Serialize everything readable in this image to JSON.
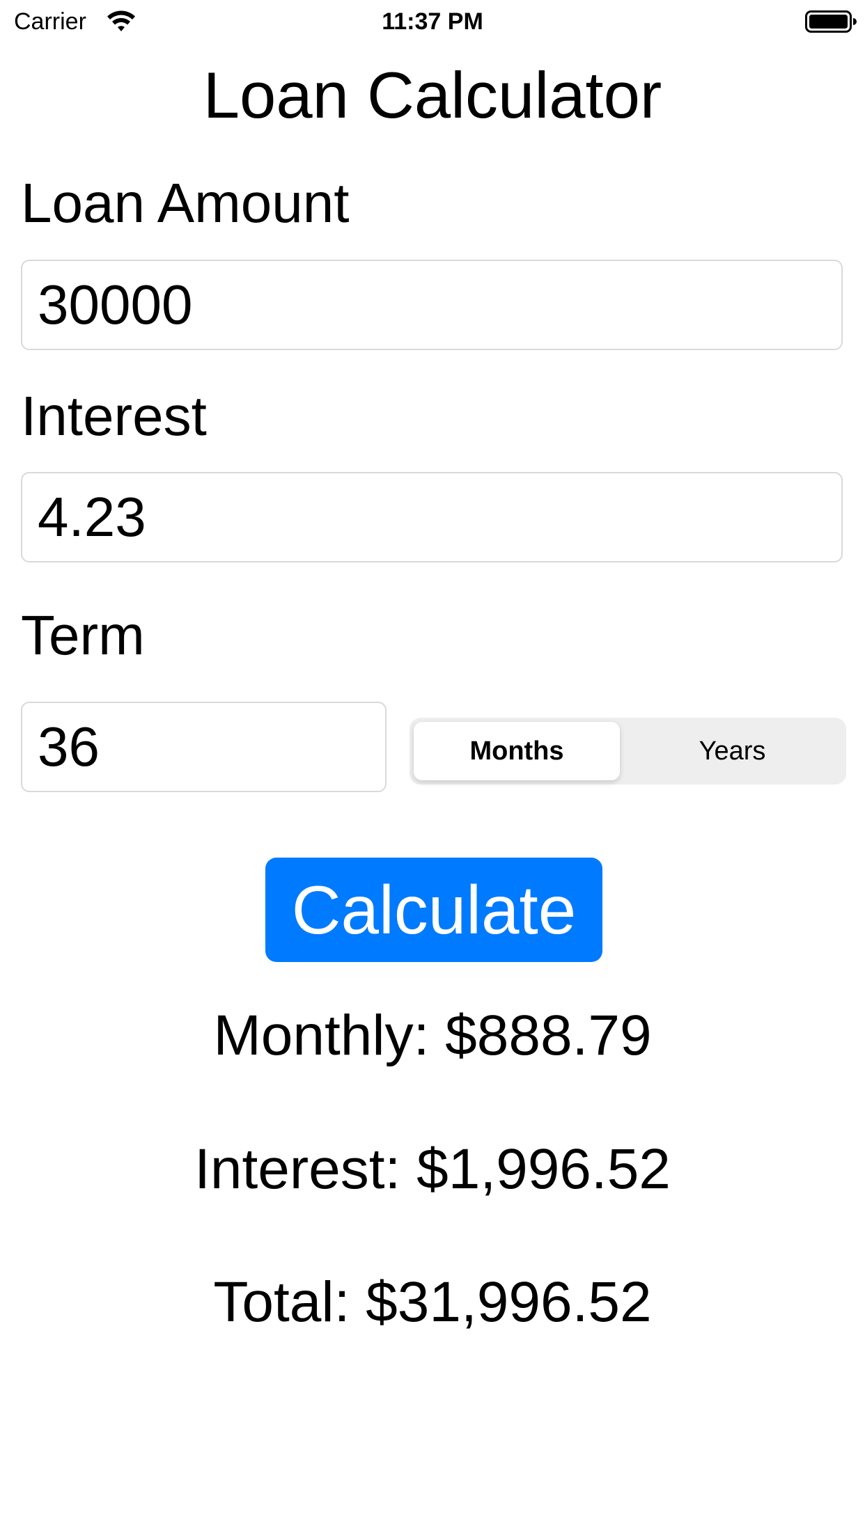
{
  "status_bar": {
    "carrier": "Carrier",
    "time": "11:37 PM",
    "wifi_icon": "wifi-icon",
    "battery_icon": "battery-icon"
  },
  "title": "Loan Calculator",
  "loan_amount": {
    "label": "Loan Amount",
    "value": "30000"
  },
  "interest": {
    "label": "Interest",
    "value": "4.23"
  },
  "term": {
    "label": "Term",
    "value": "36",
    "units": {
      "options": [
        "Months",
        "Years"
      ],
      "selected": "Months"
    }
  },
  "calculate_label": "Calculate",
  "results": {
    "monthly": "Monthly: $888.79",
    "interest": "Interest: $1,996.52",
    "total": "Total: $31,996.52"
  },
  "colors": {
    "accent": "#007aff",
    "segment_bg": "#eeeeef",
    "field_border": "#d9d9d9"
  }
}
